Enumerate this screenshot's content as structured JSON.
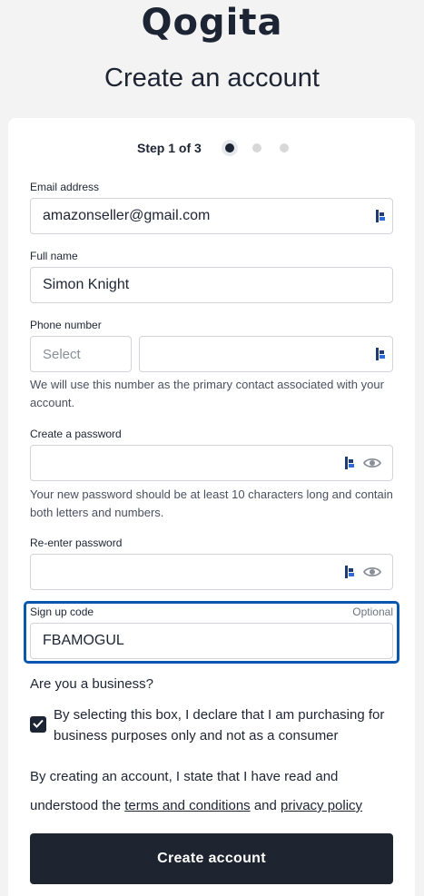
{
  "brand": {
    "logo_text": "Qogita"
  },
  "page": {
    "title": "Create an account"
  },
  "stepper": {
    "label": "Step 1 of 3",
    "current": 1,
    "total": 3
  },
  "form": {
    "email": {
      "label": "Email address",
      "value": "amazonseller@gmail.com"
    },
    "full_name": {
      "label": "Full name",
      "value": "Simon Knight"
    },
    "phone": {
      "label": "Phone number",
      "country_placeholder": "Select",
      "value": "",
      "hint": "We will use this number as the primary contact associated with your account."
    },
    "password": {
      "label": "Create a password",
      "value": "",
      "hint": "Your new password should be at least 10 characters long and contain both letters and numbers."
    },
    "password_confirm": {
      "label": "Re-enter password",
      "value": ""
    },
    "signup_code": {
      "label": "Sign up code",
      "optional_label": "Optional",
      "value": "FBAMOGUL"
    },
    "business": {
      "question": "Are you a business?",
      "checkbox_checked": true,
      "checkbox_label": "By selecting this box, I declare that I am purchasing for business purposes only and not as a consumer"
    },
    "legal": {
      "prefix": "By creating an account, I state that I have read and understood the",
      "terms_link": "terms and conditions",
      "and": "and",
      "privacy_link": "privacy policy"
    },
    "submit_label": "Create account"
  },
  "colors": {
    "background": "#f3f3f3",
    "primary_dark": "#1d2433",
    "focus_outline": "#0b57b0"
  },
  "icons": {
    "password_manager": "keeper-icon",
    "visibility": "eye-icon",
    "checkmark": "checkmark-icon"
  }
}
